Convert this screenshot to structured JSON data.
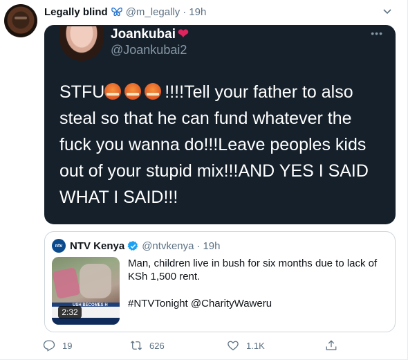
{
  "author": {
    "name": "Legally blind",
    "handle": "@m_legally",
    "time": "19h"
  },
  "screenshot": {
    "name": "Joankubai",
    "handle": "@Joankubai2",
    "text_before": "STFU",
    "text_after": "!!!!Tell your father to also steal so that he can fund whatever the fuck you wanna do!!!Leave peoples kids out of your stupid mix!!!AND YES I SAID WHAT I SAID!!!",
    "more": "•••"
  },
  "quote": {
    "avatar_text": "ntv",
    "name": "NTV Kenya",
    "handle": "@ntvkenya",
    "time": "19h",
    "text": "Man, children live in bush for six months due to lack of KSh 1,500 rent.",
    "tags": "#NTVTonight @CharityWaweru",
    "video_duration": "2:32",
    "thumbnail_caption": "USH BECOMES H"
  },
  "actions": {
    "replies": "19",
    "retweets": "626",
    "likes": "1.1K"
  },
  "colors": {
    "accent": "#1da1f2",
    "muted": "#5b7083",
    "dark_card": "#15202b"
  }
}
